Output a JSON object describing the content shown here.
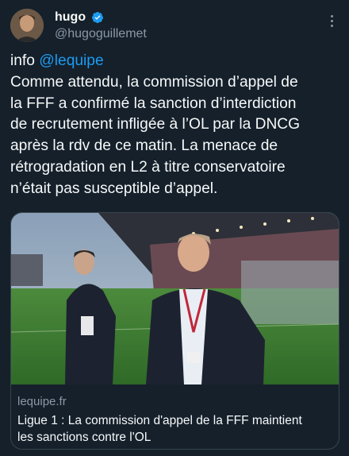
{
  "author": {
    "display_name": "hugo",
    "handle": "@hugoguillemet",
    "verified": true,
    "avatar_icon": "user-avatar"
  },
  "tweet": {
    "prefix": "info ",
    "mention": "@lequipe",
    "lines": [
      "Comme attendu, la commission d’appel de",
      "la FFF a confirmé la sanction d’interdiction",
      "de recrutement infligée à l’OL par la DNCG",
      "après la rdv de ce matin. La menace de",
      "rétrogradation en L2 à titre conservatoire",
      "n’était pas susceptible d’appel."
    ]
  },
  "link_card": {
    "domain": "lequipe.fr",
    "title_lines": [
      "Ligue 1 : La commission d'appel de la FFF maintient",
      "les sanctions contre l'OL"
    ]
  },
  "colors": {
    "background": "#15202b",
    "text": "#f7f9f9",
    "secondary": "#8b98a5",
    "accent": "#1d9bf0",
    "border": "#38444d"
  }
}
